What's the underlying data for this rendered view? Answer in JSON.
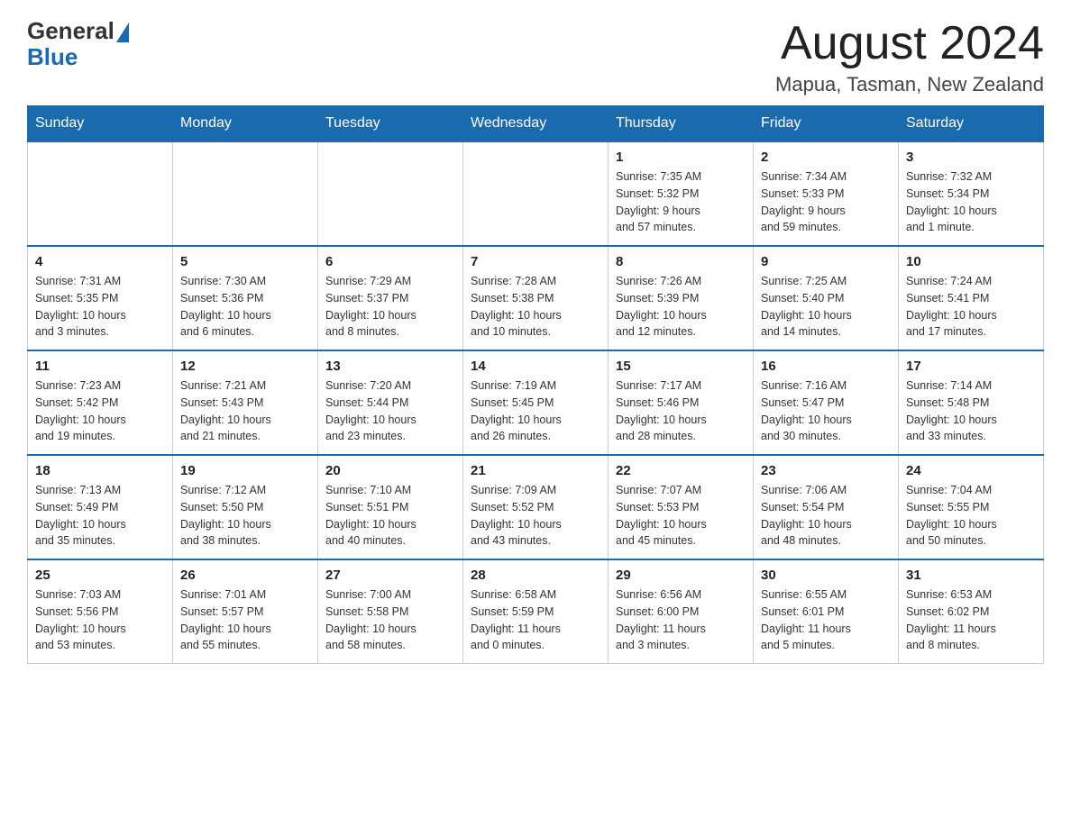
{
  "logo": {
    "text_general": "General",
    "text_blue": "Blue",
    "triangle_symbol": "▶"
  },
  "header": {
    "month_title": "August 2024",
    "location": "Mapua, Tasman, New Zealand"
  },
  "days_of_week": [
    "Sunday",
    "Monday",
    "Tuesday",
    "Wednesday",
    "Thursday",
    "Friday",
    "Saturday"
  ],
  "weeks": [
    [
      {
        "day": "",
        "info": ""
      },
      {
        "day": "",
        "info": ""
      },
      {
        "day": "",
        "info": ""
      },
      {
        "day": "",
        "info": ""
      },
      {
        "day": "1",
        "info": "Sunrise: 7:35 AM\nSunset: 5:32 PM\nDaylight: 9 hours\nand 57 minutes."
      },
      {
        "day": "2",
        "info": "Sunrise: 7:34 AM\nSunset: 5:33 PM\nDaylight: 9 hours\nand 59 minutes."
      },
      {
        "day": "3",
        "info": "Sunrise: 7:32 AM\nSunset: 5:34 PM\nDaylight: 10 hours\nand 1 minute."
      }
    ],
    [
      {
        "day": "4",
        "info": "Sunrise: 7:31 AM\nSunset: 5:35 PM\nDaylight: 10 hours\nand 3 minutes."
      },
      {
        "day": "5",
        "info": "Sunrise: 7:30 AM\nSunset: 5:36 PM\nDaylight: 10 hours\nand 6 minutes."
      },
      {
        "day": "6",
        "info": "Sunrise: 7:29 AM\nSunset: 5:37 PM\nDaylight: 10 hours\nand 8 minutes."
      },
      {
        "day": "7",
        "info": "Sunrise: 7:28 AM\nSunset: 5:38 PM\nDaylight: 10 hours\nand 10 minutes."
      },
      {
        "day": "8",
        "info": "Sunrise: 7:26 AM\nSunset: 5:39 PM\nDaylight: 10 hours\nand 12 minutes."
      },
      {
        "day": "9",
        "info": "Sunrise: 7:25 AM\nSunset: 5:40 PM\nDaylight: 10 hours\nand 14 minutes."
      },
      {
        "day": "10",
        "info": "Sunrise: 7:24 AM\nSunset: 5:41 PM\nDaylight: 10 hours\nand 17 minutes."
      }
    ],
    [
      {
        "day": "11",
        "info": "Sunrise: 7:23 AM\nSunset: 5:42 PM\nDaylight: 10 hours\nand 19 minutes."
      },
      {
        "day": "12",
        "info": "Sunrise: 7:21 AM\nSunset: 5:43 PM\nDaylight: 10 hours\nand 21 minutes."
      },
      {
        "day": "13",
        "info": "Sunrise: 7:20 AM\nSunset: 5:44 PM\nDaylight: 10 hours\nand 23 minutes."
      },
      {
        "day": "14",
        "info": "Sunrise: 7:19 AM\nSunset: 5:45 PM\nDaylight: 10 hours\nand 26 minutes."
      },
      {
        "day": "15",
        "info": "Sunrise: 7:17 AM\nSunset: 5:46 PM\nDaylight: 10 hours\nand 28 minutes."
      },
      {
        "day": "16",
        "info": "Sunrise: 7:16 AM\nSunset: 5:47 PM\nDaylight: 10 hours\nand 30 minutes."
      },
      {
        "day": "17",
        "info": "Sunrise: 7:14 AM\nSunset: 5:48 PM\nDaylight: 10 hours\nand 33 minutes."
      }
    ],
    [
      {
        "day": "18",
        "info": "Sunrise: 7:13 AM\nSunset: 5:49 PM\nDaylight: 10 hours\nand 35 minutes."
      },
      {
        "day": "19",
        "info": "Sunrise: 7:12 AM\nSunset: 5:50 PM\nDaylight: 10 hours\nand 38 minutes."
      },
      {
        "day": "20",
        "info": "Sunrise: 7:10 AM\nSunset: 5:51 PM\nDaylight: 10 hours\nand 40 minutes."
      },
      {
        "day": "21",
        "info": "Sunrise: 7:09 AM\nSunset: 5:52 PM\nDaylight: 10 hours\nand 43 minutes."
      },
      {
        "day": "22",
        "info": "Sunrise: 7:07 AM\nSunset: 5:53 PM\nDaylight: 10 hours\nand 45 minutes."
      },
      {
        "day": "23",
        "info": "Sunrise: 7:06 AM\nSunset: 5:54 PM\nDaylight: 10 hours\nand 48 minutes."
      },
      {
        "day": "24",
        "info": "Sunrise: 7:04 AM\nSunset: 5:55 PM\nDaylight: 10 hours\nand 50 minutes."
      }
    ],
    [
      {
        "day": "25",
        "info": "Sunrise: 7:03 AM\nSunset: 5:56 PM\nDaylight: 10 hours\nand 53 minutes."
      },
      {
        "day": "26",
        "info": "Sunrise: 7:01 AM\nSunset: 5:57 PM\nDaylight: 10 hours\nand 55 minutes."
      },
      {
        "day": "27",
        "info": "Sunrise: 7:00 AM\nSunset: 5:58 PM\nDaylight: 10 hours\nand 58 minutes."
      },
      {
        "day": "28",
        "info": "Sunrise: 6:58 AM\nSunset: 5:59 PM\nDaylight: 11 hours\nand 0 minutes."
      },
      {
        "day": "29",
        "info": "Sunrise: 6:56 AM\nSunset: 6:00 PM\nDaylight: 11 hours\nand 3 minutes."
      },
      {
        "day": "30",
        "info": "Sunrise: 6:55 AM\nSunset: 6:01 PM\nDaylight: 11 hours\nand 5 minutes."
      },
      {
        "day": "31",
        "info": "Sunrise: 6:53 AM\nSunset: 6:02 PM\nDaylight: 11 hours\nand 8 minutes."
      }
    ]
  ]
}
